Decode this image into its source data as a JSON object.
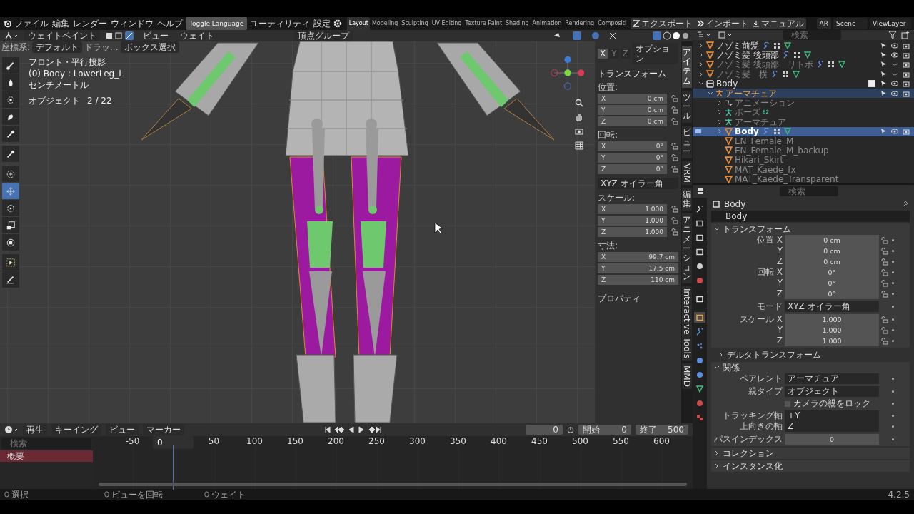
{
  "menu_bar": {
    "items": [
      "ファイル",
      "編集",
      "レンダー",
      "ウィンドウ",
      "ヘルプ"
    ],
    "toggle_button": "Toggle Language",
    "extra_items": [
      "ユーティリティ",
      "設定"
    ]
  },
  "workspace_tabs": [
    {
      "label": "Layout",
      "selected": true
    },
    {
      "label": "Modeling",
      "selected": false
    },
    {
      "label": "Sculpting",
      "selected": false
    },
    {
      "label": "UV Editing",
      "selected": false
    },
    {
      "label": "Texture Paint",
      "selected": false
    },
    {
      "label": "Shading",
      "selected": false
    },
    {
      "label": "Animation",
      "selected": false
    },
    {
      "label": "Rendering",
      "selected": false
    },
    {
      "label": "Compositi",
      "selected": false
    }
  ],
  "addon_buttons": [
    {
      "label": "エクスポート",
      "kind": "export"
    },
    {
      "label": "インポート",
      "kind": "import"
    },
    {
      "label": "マニュアル",
      "kind": "manual"
    }
  ],
  "scene_selector": {
    "engine": "AR",
    "scene": "Scene",
    "view_layer": "ViewLayer"
  },
  "viewport": {
    "mode": "ウェイトペイント",
    "menus": [
      "ビュー",
      "ウェイト"
    ],
    "vertex_group": "頂点グループ",
    "tool_settings": {
      "orientation_label": "座標系:",
      "orientation": "デフォルト",
      "drag_label": "ドラッ...",
      "select_mode": "ボックス選択"
    },
    "info": [
      "フロント・平行投影",
      "(0) Body : LowerLeg_L",
      "センチメートル"
    ],
    "object_count": {
      "label": "オブジェクト",
      "value": "2 / 22"
    },
    "tools": [
      {
        "kind": "brush",
        "selected": false
      },
      {
        "kind": "blur",
        "selected": false
      },
      {
        "kind": "average",
        "selected": false
      },
      {
        "kind": "smear",
        "selected": false
      },
      {
        "kind": "sample",
        "selected": false
      },
      {
        "kind": "gradient",
        "selected": false
      },
      {
        "kind": "cursor",
        "selected": false
      },
      {
        "kind": "move",
        "selected": true
      },
      {
        "kind": "rotate",
        "selected": false
      },
      {
        "kind": "scale",
        "selected": false
      },
      {
        "kind": "transform",
        "selected": false
      },
      {
        "kind": "select_box",
        "selected": false
      },
      {
        "kind": "annotate",
        "selected": false
      }
    ]
  },
  "sidebar": {
    "mirror_axes": [
      {
        "label": "X",
        "selected": true
      },
      {
        "label": "Y",
        "selected": false
      },
      {
        "label": "Z",
        "selected": false
      }
    ],
    "options": "オプション",
    "panel_title": "トランスフォーム",
    "sections": [
      {
        "kind": "group",
        "label": "位置:",
        "fields": [
          {
            "axis": "X",
            "value": "0 cm",
            "locked": false
          },
          {
            "axis": "Y",
            "value": "0 cm",
            "locked": false
          },
          {
            "axis": "Z",
            "value": "0 cm",
            "locked": false
          }
        ]
      },
      {
        "kind": "group",
        "label": "回転:",
        "fields": [
          {
            "axis": "X",
            "value": "0°",
            "locked": false
          },
          {
            "axis": "Y",
            "value": "0°",
            "locked": false
          },
          {
            "axis": "Z",
            "value": "0°",
            "locked": false
          }
        ]
      },
      {
        "kind": "dropdown",
        "value": "XYZ オイラー角"
      },
      {
        "kind": "group",
        "label": "スケール:",
        "fields": [
          {
            "axis": "X",
            "value": "1.000",
            "locked": false
          },
          {
            "axis": "Y",
            "value": "1.000",
            "locked": false
          },
          {
            "axis": "Z",
            "value": "1.000",
            "locked": false
          }
        ]
      },
      {
        "kind": "group",
        "label": "寸法:",
        "fields": [
          {
            "axis": "X",
            "value": "99.7 cm"
          },
          {
            "axis": "Y",
            "value": "17.5 cm"
          },
          {
            "axis": "Z",
            "value": "110 cm"
          }
        ]
      }
    ],
    "collapsed_panel": "プロパティ",
    "tabs": [
      {
        "label": "アイテム",
        "kind": "stacked",
        "selected": true
      },
      {
        "label": "ツール",
        "kind": "stacked",
        "selected": false
      },
      {
        "label": "ビュー",
        "kind": "stacked",
        "selected": false
      },
      {
        "label": "VRM",
        "kind": "rotated",
        "selected": false
      },
      {
        "label": "編集",
        "kind": "stacked",
        "selected": false
      },
      {
        "label": "アニメーション",
        "kind": "stacked",
        "selected": false
      },
      {
        "label": "Interactive Tools",
        "kind": "rotated",
        "selected": false
      },
      {
        "label": "MMD",
        "kind": "rotated",
        "selected": false
      }
    ]
  },
  "outliner": {
    "search_placeholder": "検索",
    "rows": [
      {
        "label": "ノゾミ前髪",
        "kind": "mesh",
        "visible": true,
        "expanded": false,
        "selected": false,
        "active": false
      },
      {
        "label": "ノゾミ髪 後頭部",
        "kind": "mesh",
        "visible": true,
        "expanded": false,
        "selected": false,
        "active": false
      },
      {
        "label": "ノゾミ髪 後頭部　リトポ",
        "kind": "mesh",
        "visible": false,
        "expanded": false,
        "selected": false,
        "active": false
      },
      {
        "label": "ノゾミ髪　横",
        "kind": "mesh",
        "visible": false,
        "expanded": false,
        "selected": false,
        "active": false
      },
      {
        "label": "Body",
        "kind": "collection",
        "checked": true,
        "visible": true,
        "expanded": true,
        "selected": false,
        "active": false,
        "children": [
          {
            "label": "アーマチュア",
            "kind": "armature",
            "visible": true,
            "expanded": true,
            "selected": true,
            "active": false,
            "children": [
              {
                "label": "アニメーション",
                "kind": "action",
                "expanded": false,
                "selected": false,
                "active": false
              },
              {
                "label": "ポーズ",
                "kind": "pose",
                "badge": "82",
                "expanded": false,
                "selected": false,
                "active": false
              },
              {
                "label": "アーマチュア",
                "kind": "armature_data",
                "expanded": false,
                "selected": false,
                "active": false
              },
              {
                "label": "Body",
                "kind": "mesh",
                "visible": true,
                "expanded": false,
                "selected": true,
                "active": true
              },
              {
                "label": "EN_Female_M",
                "kind": "mesh",
                "selected": false,
                "active": false
              },
              {
                "label": "EN_Female_M_backup",
                "kind": "mesh",
                "selected": false,
                "active": false
              },
              {
                "label": "Hikari_Skirt",
                "kind": "mesh",
                "selected": false,
                "active": false
              },
              {
                "label": "MAT_Kaede_fx",
                "kind": "mesh",
                "selected": false,
                "active": false
              },
              {
                "label": "MAT_Kaede_Transparent",
                "kind": "mesh",
                "selected": false,
                "active": false
              }
            ]
          }
        ]
      }
    ]
  },
  "properties": {
    "search_placeholder": "検索",
    "tabs": [
      {
        "kind": "tool",
        "selected": false
      },
      {
        "kind": "render",
        "selected": false
      },
      {
        "kind": "output",
        "selected": false
      },
      {
        "kind": "view_layer",
        "selected": false
      },
      {
        "kind": "scene",
        "selected": false
      },
      {
        "kind": "world",
        "selected": false
      },
      {
        "kind": "collection",
        "selected": false
      },
      {
        "kind": "object",
        "selected": true
      },
      {
        "kind": "modifier",
        "selected": false
      },
      {
        "kind": "particles",
        "selected": false
      },
      {
        "kind": "physics",
        "selected": false
      },
      {
        "kind": "constraints",
        "selected": false
      },
      {
        "kind": "data",
        "selected": false
      },
      {
        "kind": "material",
        "selected": false
      },
      {
        "kind": "texture",
        "selected": false
      }
    ],
    "object_name": "Body",
    "datablock": "Body",
    "panels": [
      {
        "title": "トランスフォーム",
        "expanded": true,
        "kind": "panel",
        "rows": [
          {
            "kind": "number",
            "label": "位置 X",
            "value": "0 cm",
            "locked": false
          },
          {
            "kind": "number",
            "label": "Y",
            "value": "0 cm",
            "locked": false
          },
          {
            "kind": "number",
            "label": "Z",
            "value": "0 cm",
            "locked": false
          },
          {
            "kind": "number",
            "label": "回転 X",
            "value": "0°",
            "locked": false
          },
          {
            "kind": "number",
            "label": "Y",
            "value": "0°",
            "locked": false
          },
          {
            "kind": "number",
            "label": "Z",
            "value": "0°",
            "locked": false
          },
          {
            "kind": "dropdown",
            "label": "モード",
            "value": "XYZ オイラー角"
          },
          {
            "kind": "number",
            "label": "スケール X",
            "value": "1.000",
            "locked": false
          },
          {
            "kind": "number",
            "label": "Y",
            "value": "1.000",
            "locked": false
          },
          {
            "kind": "number",
            "label": "Z",
            "value": "1.000",
            "locked": false
          }
        ]
      },
      {
        "title": "デルタトランスフォーム",
        "expanded": false,
        "kind": "subpanel"
      },
      {
        "title": "関係",
        "expanded": true,
        "kind": "panel",
        "rows": [
          {
            "kind": "object",
            "label": "ペアレント",
            "value": "アーマチュア"
          },
          {
            "kind": "dropdown",
            "label": "親タイプ",
            "value": "オブジェクト"
          },
          {
            "kind": "checkbox",
            "value": "カメラの親をロック",
            "checked": false
          },
          {
            "kind": "dropdown",
            "label": "トラッキング軸",
            "value": "+Y"
          },
          {
            "kind": "dropdown",
            "label": "上向きの軸",
            "value": "Z"
          },
          {
            "kind": "number",
            "label": "パスインデックス",
            "value": "0"
          }
        ]
      },
      {
        "title": "コレクション",
        "expanded": false,
        "kind": "panel"
      },
      {
        "title": "インスタンス化",
        "expanded": false,
        "kind": "panel"
      }
    ]
  },
  "timeline": {
    "menus": [
      "再生",
      "キーイング",
      "ビュー",
      "マーカー"
    ],
    "current_frame": "0",
    "start_label": "開始",
    "start": "0",
    "end_label": "終了",
    "end": "500",
    "search_placeholder": "検索",
    "channel": "概要",
    "ruler": [
      {
        "label": "-50",
        "kind": "tick"
      },
      {
        "label": "0",
        "kind": "playhead"
      },
      {
        "label": "50",
        "kind": "tick"
      },
      {
        "label": "100",
        "kind": "tick"
      },
      {
        "label": "150",
        "kind": "tick"
      },
      {
        "label": "200",
        "kind": "tick"
      },
      {
        "label": "250",
        "kind": "tick"
      },
      {
        "label": "300",
        "kind": "tick"
      },
      {
        "label": "350",
        "kind": "tick"
      },
      {
        "label": "400",
        "kind": "tick"
      },
      {
        "label": "450",
        "kind": "tick"
      },
      {
        "label": "500",
        "kind": "tick"
      },
      {
        "label": "550",
        "kind": "tick"
      },
      {
        "label": "600",
        "kind": "tick"
      }
    ]
  },
  "status_bar": {
    "hints": [
      "選択",
      "ビューを回転",
      "ウェイト"
    ],
    "version": "4.2.5"
  }
}
